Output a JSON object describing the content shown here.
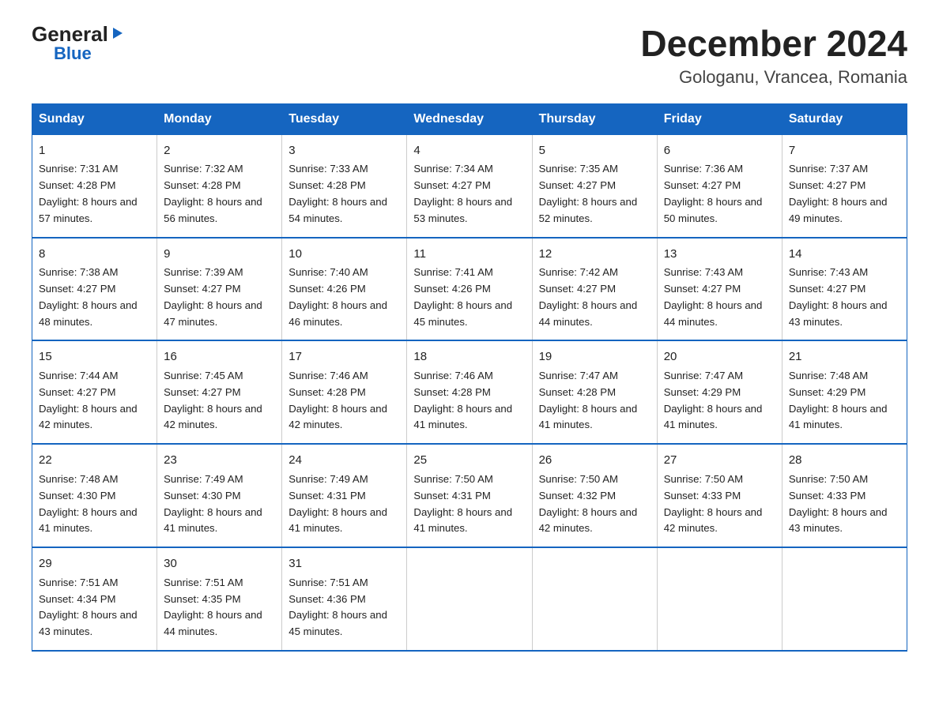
{
  "logo": {
    "general": "General",
    "triangle": "▶",
    "blue": "Blue"
  },
  "title": "December 2024",
  "subtitle": "Gologanu, Vrancea, Romania",
  "headers": [
    "Sunday",
    "Monday",
    "Tuesday",
    "Wednesday",
    "Thursday",
    "Friday",
    "Saturday"
  ],
  "weeks": [
    [
      {
        "day": "1",
        "sunrise": "7:31 AM",
        "sunset": "4:28 PM",
        "daylight": "8 hours and 57 minutes."
      },
      {
        "day": "2",
        "sunrise": "7:32 AM",
        "sunset": "4:28 PM",
        "daylight": "8 hours and 56 minutes."
      },
      {
        "day": "3",
        "sunrise": "7:33 AM",
        "sunset": "4:28 PM",
        "daylight": "8 hours and 54 minutes."
      },
      {
        "day": "4",
        "sunrise": "7:34 AM",
        "sunset": "4:27 PM",
        "daylight": "8 hours and 53 minutes."
      },
      {
        "day": "5",
        "sunrise": "7:35 AM",
        "sunset": "4:27 PM",
        "daylight": "8 hours and 52 minutes."
      },
      {
        "day": "6",
        "sunrise": "7:36 AM",
        "sunset": "4:27 PM",
        "daylight": "8 hours and 50 minutes."
      },
      {
        "day": "7",
        "sunrise": "7:37 AM",
        "sunset": "4:27 PM",
        "daylight": "8 hours and 49 minutes."
      }
    ],
    [
      {
        "day": "8",
        "sunrise": "7:38 AM",
        "sunset": "4:27 PM",
        "daylight": "8 hours and 48 minutes."
      },
      {
        "day": "9",
        "sunrise": "7:39 AM",
        "sunset": "4:27 PM",
        "daylight": "8 hours and 47 minutes."
      },
      {
        "day": "10",
        "sunrise": "7:40 AM",
        "sunset": "4:26 PM",
        "daylight": "8 hours and 46 minutes."
      },
      {
        "day": "11",
        "sunrise": "7:41 AM",
        "sunset": "4:26 PM",
        "daylight": "8 hours and 45 minutes."
      },
      {
        "day": "12",
        "sunrise": "7:42 AM",
        "sunset": "4:27 PM",
        "daylight": "8 hours and 44 minutes."
      },
      {
        "day": "13",
        "sunrise": "7:43 AM",
        "sunset": "4:27 PM",
        "daylight": "8 hours and 44 minutes."
      },
      {
        "day": "14",
        "sunrise": "7:43 AM",
        "sunset": "4:27 PM",
        "daylight": "8 hours and 43 minutes."
      }
    ],
    [
      {
        "day": "15",
        "sunrise": "7:44 AM",
        "sunset": "4:27 PM",
        "daylight": "8 hours and 42 minutes."
      },
      {
        "day": "16",
        "sunrise": "7:45 AM",
        "sunset": "4:27 PM",
        "daylight": "8 hours and 42 minutes."
      },
      {
        "day": "17",
        "sunrise": "7:46 AM",
        "sunset": "4:28 PM",
        "daylight": "8 hours and 42 minutes."
      },
      {
        "day": "18",
        "sunrise": "7:46 AM",
        "sunset": "4:28 PM",
        "daylight": "8 hours and 41 minutes."
      },
      {
        "day": "19",
        "sunrise": "7:47 AM",
        "sunset": "4:28 PM",
        "daylight": "8 hours and 41 minutes."
      },
      {
        "day": "20",
        "sunrise": "7:47 AM",
        "sunset": "4:29 PM",
        "daylight": "8 hours and 41 minutes."
      },
      {
        "day": "21",
        "sunrise": "7:48 AM",
        "sunset": "4:29 PM",
        "daylight": "8 hours and 41 minutes."
      }
    ],
    [
      {
        "day": "22",
        "sunrise": "7:48 AM",
        "sunset": "4:30 PM",
        "daylight": "8 hours and 41 minutes."
      },
      {
        "day": "23",
        "sunrise": "7:49 AM",
        "sunset": "4:30 PM",
        "daylight": "8 hours and 41 minutes."
      },
      {
        "day": "24",
        "sunrise": "7:49 AM",
        "sunset": "4:31 PM",
        "daylight": "8 hours and 41 minutes."
      },
      {
        "day": "25",
        "sunrise": "7:50 AM",
        "sunset": "4:31 PM",
        "daylight": "8 hours and 41 minutes."
      },
      {
        "day": "26",
        "sunrise": "7:50 AM",
        "sunset": "4:32 PM",
        "daylight": "8 hours and 42 minutes."
      },
      {
        "day": "27",
        "sunrise": "7:50 AM",
        "sunset": "4:33 PM",
        "daylight": "8 hours and 42 minutes."
      },
      {
        "day": "28",
        "sunrise": "7:50 AM",
        "sunset": "4:33 PM",
        "daylight": "8 hours and 43 minutes."
      }
    ],
    [
      {
        "day": "29",
        "sunrise": "7:51 AM",
        "sunset": "4:34 PM",
        "daylight": "8 hours and 43 minutes."
      },
      {
        "day": "30",
        "sunrise": "7:51 AM",
        "sunset": "4:35 PM",
        "daylight": "8 hours and 44 minutes."
      },
      {
        "day": "31",
        "sunrise": "7:51 AM",
        "sunset": "4:36 PM",
        "daylight": "8 hours and 45 minutes."
      },
      null,
      null,
      null,
      null
    ]
  ],
  "labels": {
    "sunrise": "Sunrise:",
    "sunset": "Sunset:",
    "daylight": "Daylight:"
  }
}
